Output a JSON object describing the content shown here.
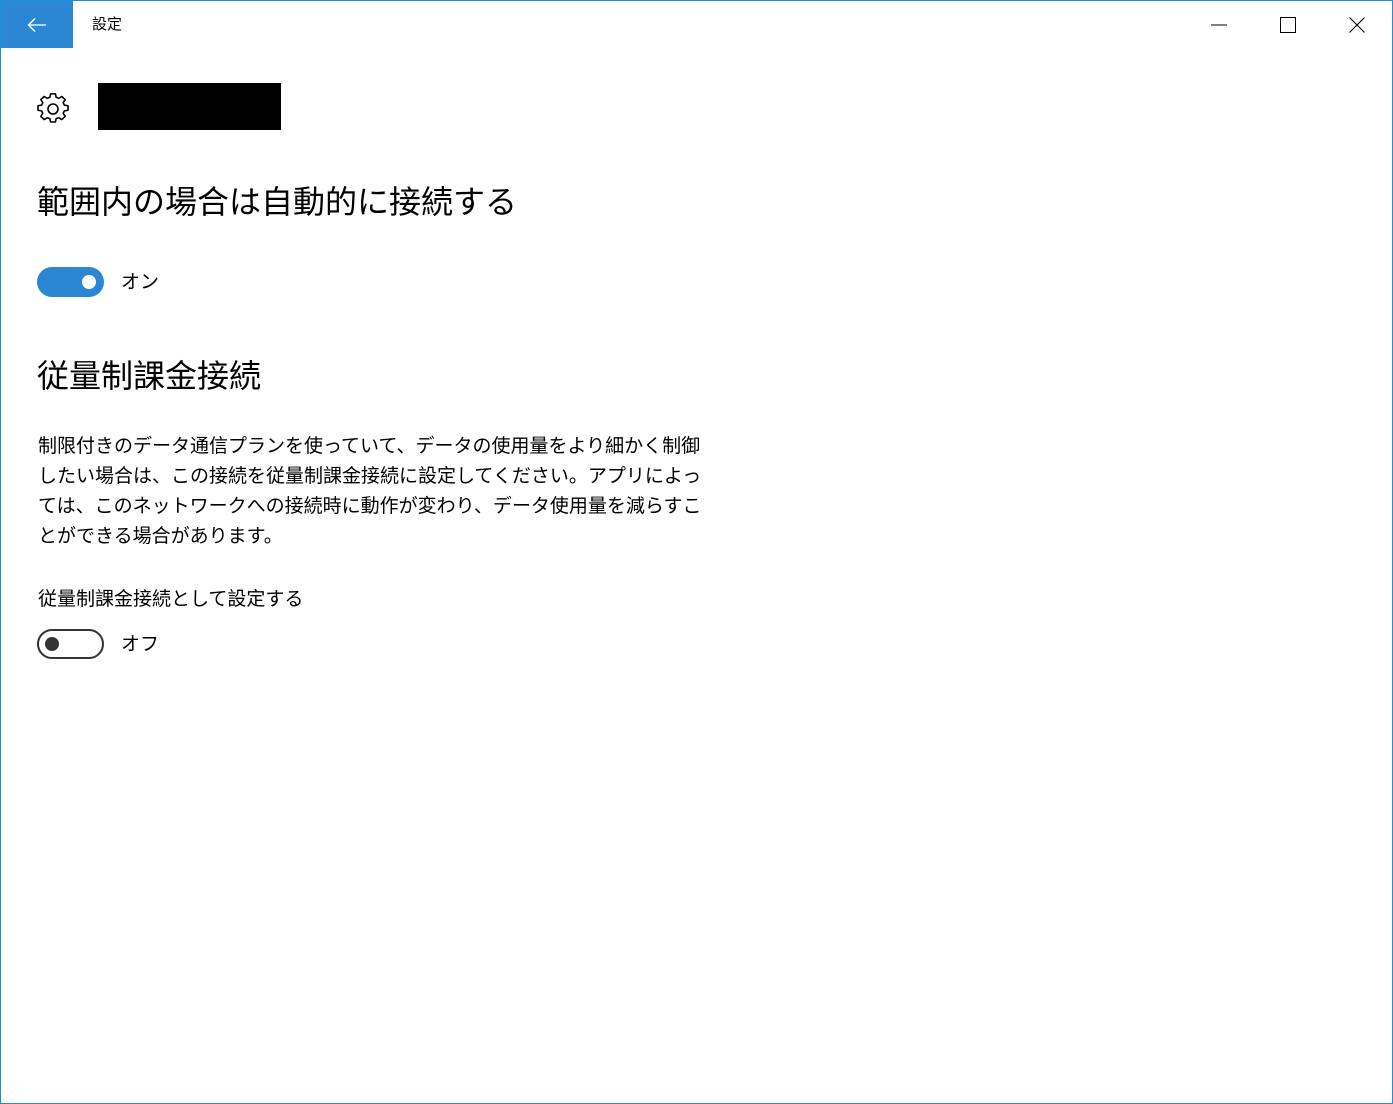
{
  "window": {
    "title": "設定",
    "accent_color": "#2b87d3"
  },
  "icons": {
    "back": "back-arrow-icon",
    "minimize": "minimize-icon",
    "maximize": "maximize-icon",
    "close": "close-icon",
    "settings": "gear-icon"
  },
  "header": {
    "network_name": ""
  },
  "auto_connect": {
    "heading": "範囲内の場合は自動的に接続する",
    "toggle_state": true,
    "toggle_label": "オン"
  },
  "metered": {
    "heading": "従量制課金接続",
    "description": "制限付きのデータ通信プランを使っていて、データの使用量をより細かく制御したい場合は、この接続を従量制課金接続に設定してください。アプリによっては、このネットワークへの接続時に動作が変わり、データ使用量を減らすことができる場合があります。",
    "setting_label": "従量制課金接続として設定する",
    "toggle_state": false,
    "toggle_label": "オフ"
  }
}
